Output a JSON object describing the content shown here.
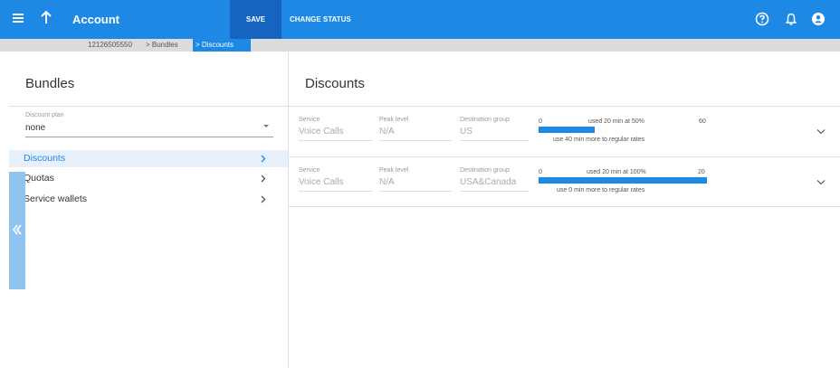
{
  "header": {
    "title": "Account",
    "save_label": "SAVE",
    "change_status_label": "CHANGE STATUS",
    "icons": [
      "menu-icon",
      "back-arrow-icon",
      "help-icon",
      "notifications-icon",
      "user-icon"
    ]
  },
  "breadcrumb": {
    "account": "12126505550",
    "bundles": "> Bundles",
    "current": "> Discounts"
  },
  "sidebar": {
    "title": "Bundles",
    "discount_plan": {
      "label": "Discount plan",
      "value": "none"
    },
    "items": [
      {
        "label": "Discounts",
        "active": true
      },
      {
        "label": "Quotas",
        "active": false
      },
      {
        "label": "Service wallets",
        "active": false
      }
    ]
  },
  "main": {
    "title": "Discounts",
    "field_labels": {
      "service": "Service",
      "peak": "Peak level",
      "destination": "Destination group"
    },
    "rows": [
      {
        "service": "Voice Calls",
        "peak": "N/A",
        "destination": "US",
        "min": "0",
        "usage": "used 20 min at 50%",
        "max": "60",
        "fill_fraction": 0.3333,
        "note": "use 40 min more to regular rates"
      },
      {
        "service": "Voice Calls",
        "peak": "N/A",
        "destination": "USA&Canada",
        "min": "0",
        "usage": "used 20 min at 100%",
        "max": "20",
        "fill_fraction": 1.0,
        "note": "use 0 min more to regular rates"
      }
    ]
  },
  "colors": {
    "accent": "#1e88e5",
    "accent_dark": "#1565c0",
    "breadcrumb_bg": "#dcdcdc",
    "active_bg": "#e8f1fb"
  }
}
